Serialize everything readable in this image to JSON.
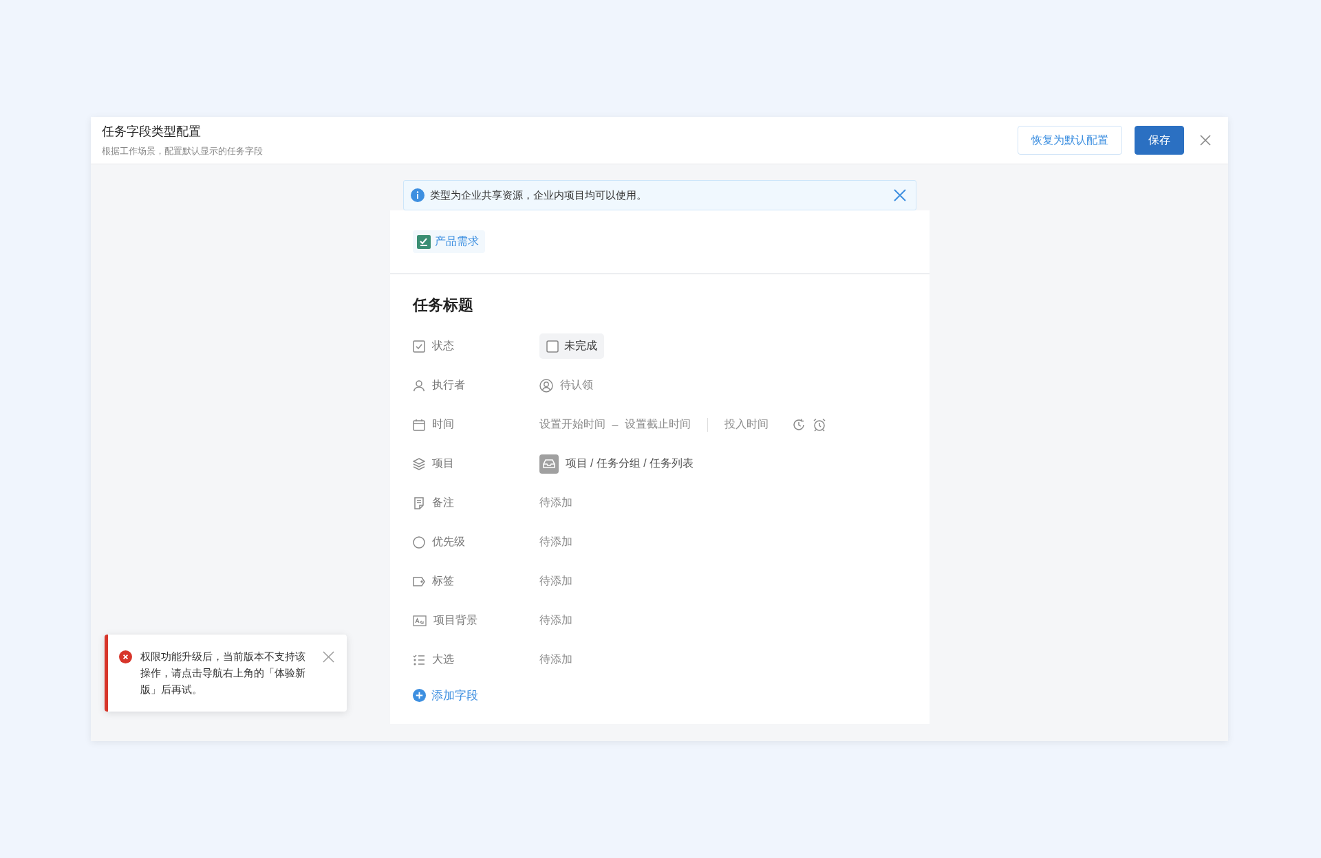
{
  "dialog": {
    "title": "任务字段类型配置",
    "subtitle": "根据工作场景，配置默认显示的任务字段",
    "buttons": [
      {
        "kind": "secondary",
        "label": "恢复为默认配置"
      },
      {
        "kind": "primary",
        "label": "保存"
      }
    ]
  },
  "notice": {
    "text": "类型为企业共享资源，企业内项目均可以使用。"
  },
  "type_tag": {
    "label": "产品需求"
  },
  "task": {
    "title": "任务标题",
    "fields": [
      {
        "kind": "status",
        "label": "状态",
        "value": "未完成",
        "checked": false
      },
      {
        "kind": "assignee",
        "label": "执行者",
        "value": "待认领"
      },
      {
        "kind": "time",
        "label": "时间",
        "start": "设置开始时间",
        "separator": "–",
        "end": "设置截止时间",
        "effort": "投入时间"
      },
      {
        "kind": "project",
        "label": "项目",
        "value": "项目 / 任务分组 / 任务列表"
      },
      {
        "kind": "text",
        "label": "备注",
        "value": "待添加"
      },
      {
        "kind": "text",
        "label": "优先级",
        "value": "待添加"
      },
      {
        "kind": "text",
        "label": "标签",
        "value": "待添加"
      },
      {
        "kind": "text",
        "label": "项目背景",
        "value": "待添加"
      },
      {
        "kind": "text",
        "label": "大选",
        "value": "待添加"
      }
    ],
    "add_field": "添加字段"
  },
  "toast": {
    "kind": "error",
    "text": "权限功能升级后，当前版本不支持该操作，请点击导航右上角的「体验新版」后再试。"
  }
}
